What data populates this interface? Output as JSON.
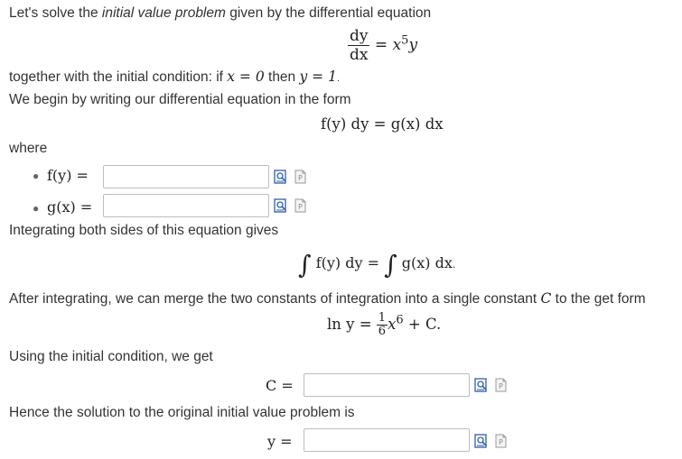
{
  "intro": {
    "prefix": "Let's solve the ",
    "emph": "initial value problem",
    "suffix": " given by the differential equation"
  },
  "ode": {
    "num": "dy",
    "den": "dx",
    "rhs_eq": "=",
    "rhs_var": "x",
    "rhs_exp": "5",
    "rhs_y": "y"
  },
  "initial": {
    "prefix": "together with the initial condition: if ",
    "x_eq": "x = 0",
    "then": " then ",
    "y_eq": "y = 1",
    "period": "."
  },
  "separable": {
    "text": "We begin by writing our differential equation in the form",
    "formula": "f(y) dy = g(x) dx"
  },
  "where_label": "where",
  "fields": {
    "f_label": "f(y) =",
    "g_label": "g(x) =",
    "f_value": "",
    "g_value": "",
    "c_label": "C =",
    "c_value": "",
    "y_label": "y =",
    "y_value": ""
  },
  "integrating": {
    "text": "Integrating both sides of this equation gives",
    "lhs": "f(y) dy",
    "eq": "=",
    "rhs": "g(x) dx",
    "period": "."
  },
  "merge": {
    "prefix": "After integrating, we can merge the two constants of integration into a single constant ",
    "C": "C",
    "suffix": " to the get form"
  },
  "general": {
    "lhs": "ln y =",
    "num": "1",
    "den": "6",
    "var": "x",
    "exp": "6",
    "tail": "+ C."
  },
  "using_text": "Using the initial condition, we get",
  "hence_text": "Hence the solution to the original initial value problem is",
  "icons": {
    "preview": "preview-icon",
    "help": "help-document-icon"
  },
  "colors": {
    "input_border": "#bdbdbd",
    "icon_blue": "#2f5fa8"
  }
}
